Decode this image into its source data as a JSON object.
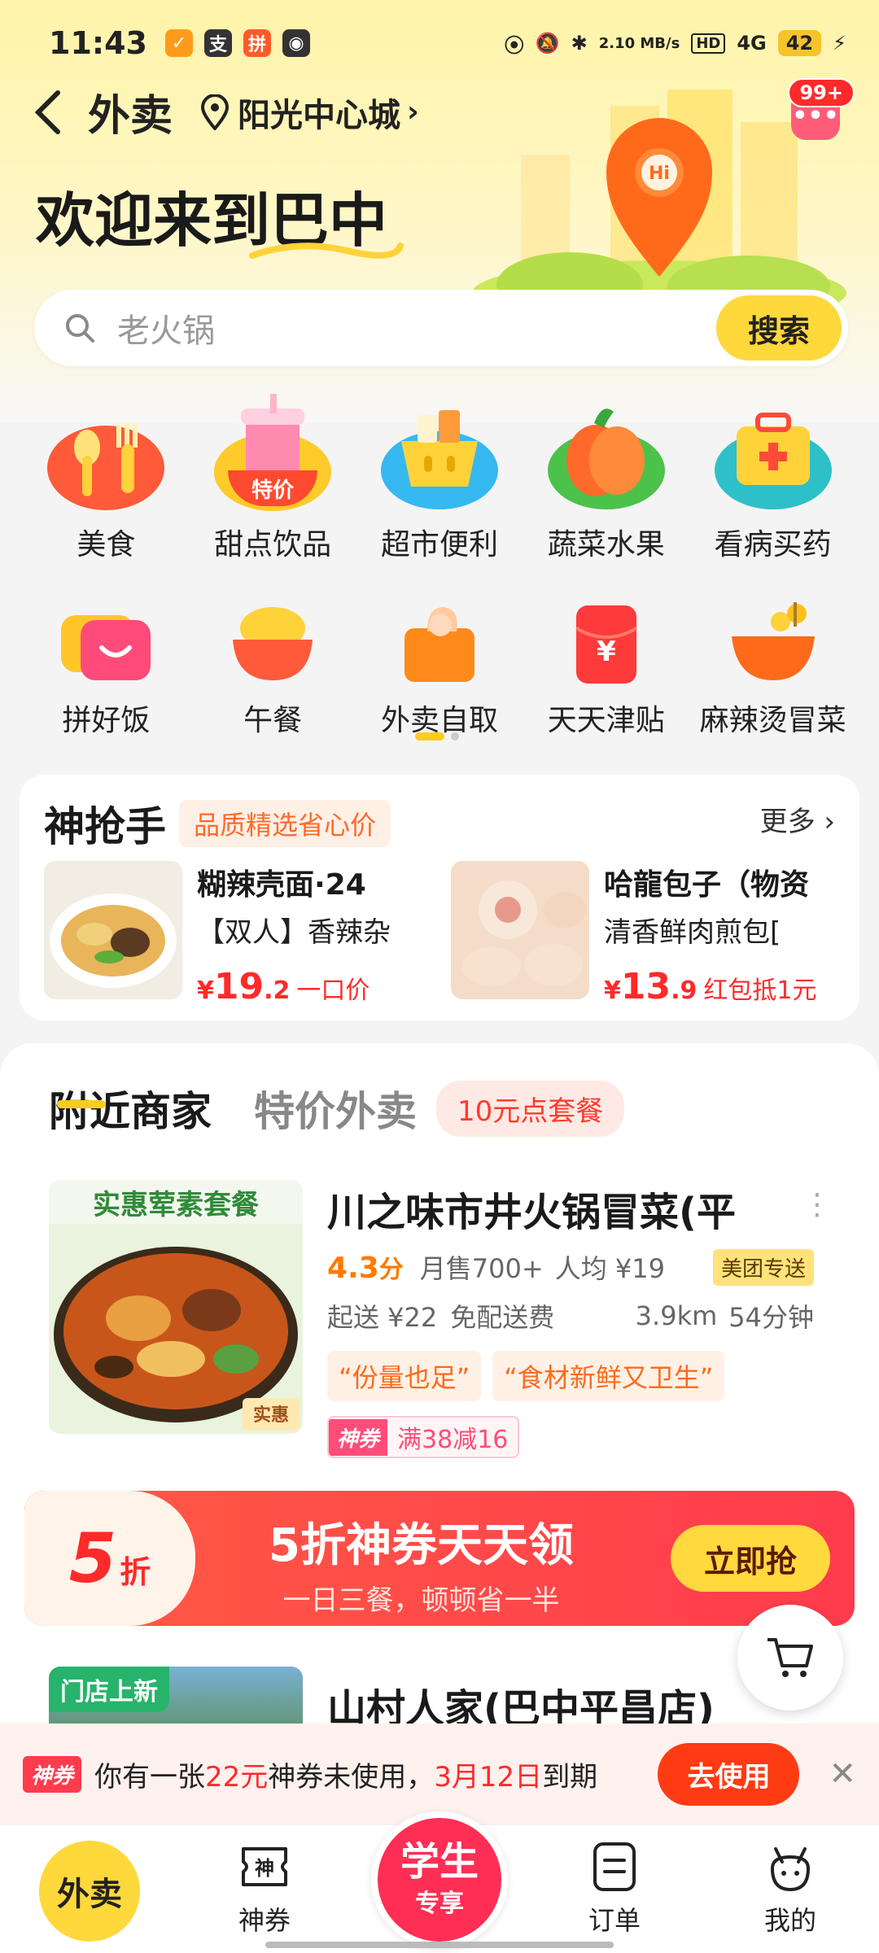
{
  "status": {
    "time": "11:43",
    "net_speed": "2.10 MB/s",
    "network": "4G",
    "hd": "HD",
    "battery": "42"
  },
  "nav": {
    "title": "外卖",
    "location": "阳光中心城",
    "msg_badge": "99+"
  },
  "welcome": "欢迎来到巴中",
  "search": {
    "placeholder": "老火锅",
    "button": "搜索"
  },
  "categories_row1": [
    {
      "label": "美食",
      "icon": "food-icon"
    },
    {
      "label": "甜点饮品",
      "icon": "drink-icon",
      "tag": "特价"
    },
    {
      "label": "超市便利",
      "icon": "basket-icon"
    },
    {
      "label": "蔬菜水果",
      "icon": "fruit-icon"
    },
    {
      "label": "看病买药",
      "icon": "medkit-icon"
    }
  ],
  "categories_row2": [
    {
      "label": "拼好饭",
      "icon": "bowl-icon"
    },
    {
      "label": "午餐",
      "icon": "rice-icon"
    },
    {
      "label": "外卖自取",
      "icon": "bag-icon"
    },
    {
      "label": "天天津贴",
      "icon": "hongbao-icon"
    },
    {
      "label": "麻辣烫冒菜",
      "icon": "malatang-icon"
    }
  ],
  "flash": {
    "title": "神抢手",
    "tag": "品质精选省心价",
    "more": "更多",
    "deals": [
      {
        "name": "糊辣壳面·24",
        "sub": "【双人】香辣杂",
        "yen": "¥",
        "price_int": "19",
        "price_dec": ".2",
        "note": "一口价"
      },
      {
        "name": "哈龍包子（物资",
        "sub": "清香鲜肉煎包[",
        "yen": "¥",
        "price_int": "13",
        "price_dec": ".9",
        "note": "红包抵1元"
      }
    ]
  },
  "tabs": {
    "active": "附近商家",
    "inactive": "特价外卖",
    "pill": "10元点套餐"
  },
  "shop": {
    "name": "川之味市井火锅冒菜(平",
    "rating": "4.3",
    "rating_unit": "分",
    "monthly": "月售700+",
    "avg": "人均 ¥19",
    "badge": "美团专送",
    "min_order": "起送 ¥22",
    "delivery_fee": "免配送费",
    "distance": "3.9km",
    "eta": "54分钟",
    "quotes": [
      "“份量也足”",
      "“食材新鲜又卫生”"
    ],
    "coupon_tag": "神券",
    "coupon_value": "满38减16",
    "img_text": "实惠荤素套餐",
    "img_stamp": "实惠"
  },
  "banner": {
    "num": "5",
    "zhe": "折",
    "title": "5折神券天天领",
    "sub": "一日三餐，顿顿省一半",
    "button": "立即抢"
  },
  "shop2": {
    "tag": "门店上新",
    "name": "山村人家(巴中平昌店)"
  },
  "toast": {
    "tag": "神券",
    "text_a": "你有一张",
    "amount": "22元",
    "text_b": "神券未使用，",
    "date": "3月12日",
    "text_c": "到期",
    "button": "去使用",
    "close": "✕"
  },
  "bottom_nav": {
    "home": "外卖",
    "coupon": "神券",
    "student_1": "学生",
    "student_2": "专享",
    "orders": "订单",
    "mine": "我的"
  }
}
